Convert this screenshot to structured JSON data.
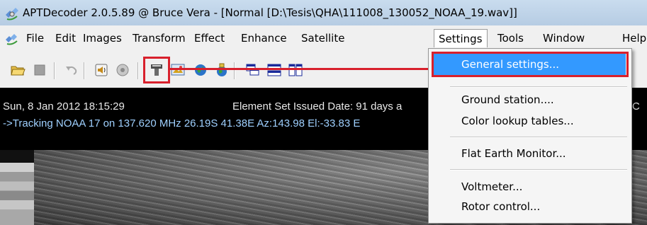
{
  "window": {
    "title": "APTDecoder 2.0.5.89 @ Bruce Vera - [Normal [D:\\Tesis\\QHA\\111008_130052_NOAA_19.wav]]"
  },
  "menubar": {
    "items": [
      "File",
      "Edit",
      "Images",
      "Transform",
      "Effect",
      "Enhance",
      "Satellite",
      "Settings",
      "Tools",
      "Window",
      "Help"
    ],
    "active": "Settings"
  },
  "status": {
    "datetime": "Sun, 8 Jan 2012 18:15:29",
    "element_set": "Element Set Issued Date: 91 days a",
    "tracking": "->Tracking NOAA 17 on 137.620 MHz 26.19S 41.38E Az:143.98 El:-33.83 E",
    "right_char": "C"
  },
  "settings_menu": {
    "items": [
      {
        "label": "General settings...",
        "highlighted": true
      },
      {
        "label": "Ground station...."
      },
      {
        "label": "Color lookup tables..."
      },
      {
        "label": "Flat Earth Monitor..."
      },
      {
        "label": "Voltmeter..."
      },
      {
        "label": "Rotor control..."
      }
    ]
  },
  "colors": {
    "highlight": "#3399ff",
    "annotation_red": "#d8202c"
  }
}
